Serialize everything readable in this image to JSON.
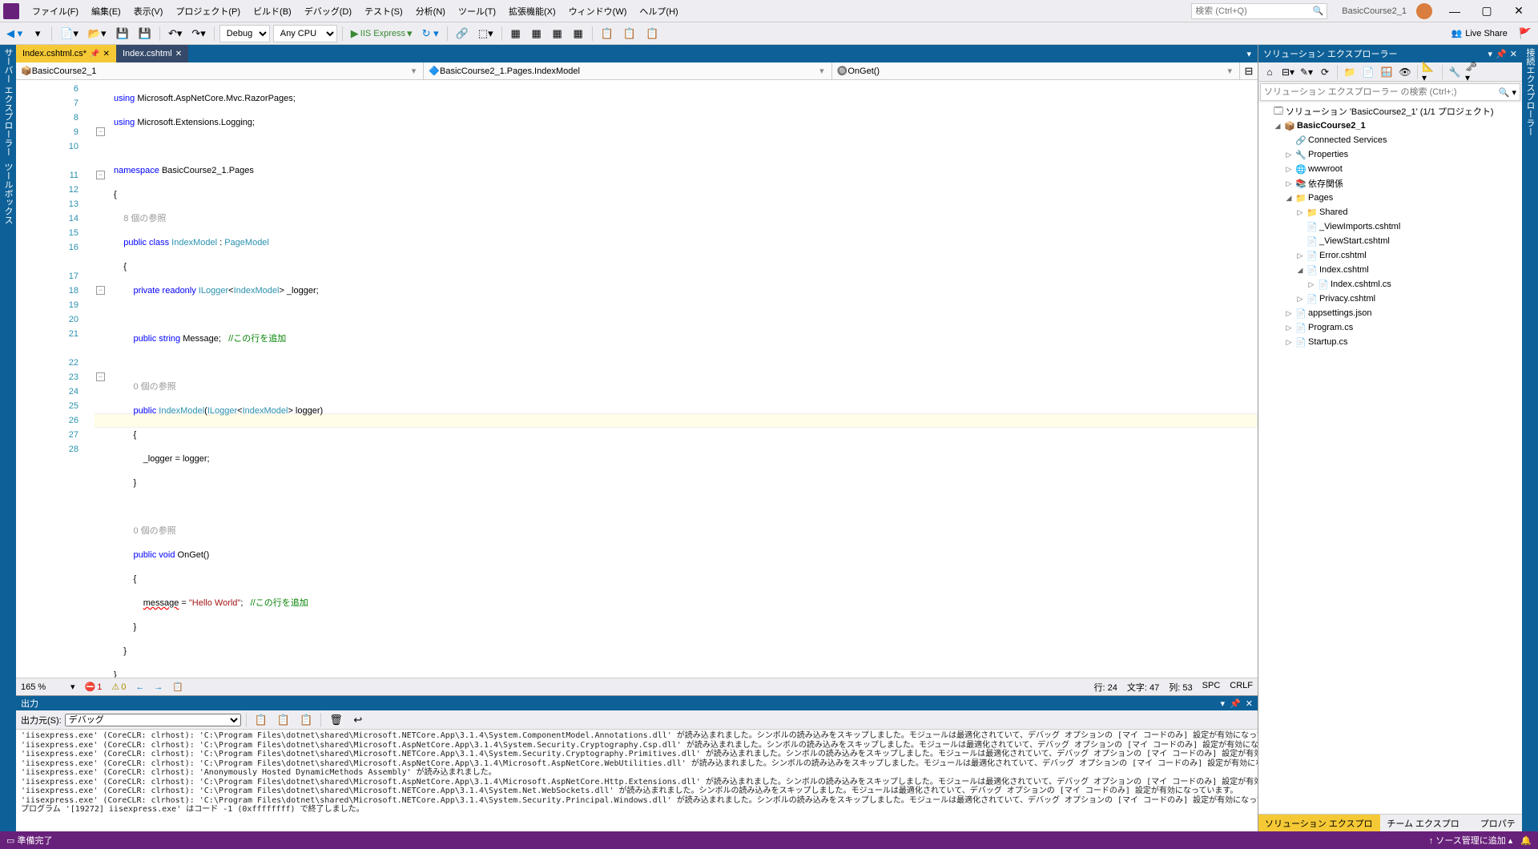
{
  "title": {
    "solution": "BasicCourse2_1"
  },
  "menu": [
    "ファイル(F)",
    "編集(E)",
    "表示(V)",
    "プロジェクト(P)",
    "ビルド(B)",
    "デバッグ(D)",
    "テスト(S)",
    "分析(N)",
    "ツール(T)",
    "拡張機能(X)",
    "ウィンドウ(W)",
    "ヘルプ(H)"
  ],
  "search": {
    "placeholder": "検索 (Ctrl+Q)"
  },
  "toolbar": {
    "config": "Debug",
    "platform": "Any CPU",
    "run": "IIS Express",
    "liveshare": "Live Share"
  },
  "tabs": [
    {
      "label": "Index.cshtml.cs*",
      "active": true,
      "pinned": true
    },
    {
      "label": "Index.cshtml",
      "active": false
    }
  ],
  "navbar": {
    "scope": "BasicCourse2_1",
    "class": "BasicCourse2_1.Pages.IndexModel",
    "member": "OnGet()"
  },
  "code": {
    "lines": [
      6,
      7,
      8,
      9,
      10,
      11,
      12,
      13,
      14,
      15,
      16,
      17,
      18,
      19,
      20,
      21,
      22,
      23,
      24,
      25,
      26,
      27,
      28
    ],
    "ref1": "8 個の参照",
    "ref2": "0 個の参照",
    "ref3": "0 個の参照",
    "t_using": "using",
    "t_ns": "namespace",
    "t_pub": "public",
    "t_cls": "class",
    "t_priv": "private",
    "t_ro": "readonly",
    "t_str": "string",
    "t_void": "void",
    "ns": "Microsoft.AspNetCore.Mvc.RazorPages",
    "ns2": "Microsoft.Extensions.Logging",
    "nsdecl": "BasicCourse2_1.Pages",
    "clsname": "IndexModel",
    "base": "PageModel",
    "ilog": "ILogger",
    "logfield": "_logger",
    "msg": "Message",
    "onget": "OnGet",
    "hello": "\"Hello World\"",
    "msgerr": "message",
    "c1": "//この行を追加",
    "c2": "//この行を追加",
    "logger": "logger"
  },
  "edstatus": {
    "zoom": "165 %",
    "err": "1",
    "warn": "0",
    "line": "行: 24",
    "ch": "文字: 47",
    "col": "列: 53",
    "spc": "SPC",
    "crlf": "CRLF"
  },
  "solExp": {
    "title": "ソリューション エクスプローラー",
    "search": "ソリューション エクスプローラー の検索 (Ctrl+;)",
    "tree": [
      {
        "d": 0,
        "tw": "",
        "i": "🗔",
        "t": "ソリューション 'BasicCourse2_1' (1/1 プロジェクト)"
      },
      {
        "d": 1,
        "tw": "◢",
        "i": "📦",
        "t": "BasicCourse2_1",
        "bold": true
      },
      {
        "d": 2,
        "tw": "",
        "i": "🔗",
        "t": "Connected Services"
      },
      {
        "d": 2,
        "tw": "▷",
        "i": "🔧",
        "t": "Properties"
      },
      {
        "d": 2,
        "tw": "▷",
        "i": "🌐",
        "t": "wwwroot"
      },
      {
        "d": 2,
        "tw": "▷",
        "i": "📚",
        "t": "依存関係"
      },
      {
        "d": 2,
        "tw": "◢",
        "i": "📁",
        "t": "Pages"
      },
      {
        "d": 3,
        "tw": "▷",
        "i": "📁",
        "t": "Shared"
      },
      {
        "d": 3,
        "tw": "",
        "i": "📄",
        "t": "_ViewImports.cshtml"
      },
      {
        "d": 3,
        "tw": "",
        "i": "📄",
        "t": "_ViewStart.cshtml"
      },
      {
        "d": 3,
        "tw": "▷",
        "i": "📄",
        "t": "Error.cshtml"
      },
      {
        "d": 3,
        "tw": "◢",
        "i": "📄",
        "t": "Index.cshtml"
      },
      {
        "d": 4,
        "tw": "▷",
        "i": "📄",
        "t": "Index.cshtml.cs"
      },
      {
        "d": 3,
        "tw": "▷",
        "i": "📄",
        "t": "Privacy.cshtml"
      },
      {
        "d": 2,
        "tw": "▷",
        "i": "📄",
        "t": "appsettings.json"
      },
      {
        "d": 2,
        "tw": "▷",
        "i": "📄",
        "t": "Program.cs"
      },
      {
        "d": 2,
        "tw": "▷",
        "i": "📄",
        "t": "Startup.cs"
      }
    ],
    "tabs": [
      "ソリューション エクスプローラー",
      "チーム エクスプローラー",
      "プロパティ"
    ]
  },
  "rightStrip": "接続エクスプローラー",
  "leftStrip": [
    "サーバー エクスプローラー",
    "ツールボックス"
  ],
  "output": {
    "title": "出力",
    "srcLabel": "出力元(S):",
    "src": "デバッグ",
    "lines": [
      "'iisexpress.exe' (CoreCLR: clrhost): 'C:\\Program Files\\dotnet\\shared\\Microsoft.NETCore.App\\3.1.4\\System.ComponentModel.Annotations.dll' が読み込まれました。シンボルの読み込みをスキップしました。モジュールは最適化されていて、デバッグ オプションの [マイ コードのみ] 設定が有効になっています。",
      "'iisexpress.exe' (CoreCLR: clrhost): 'C:\\Program Files\\dotnet\\shared\\Microsoft.AspNetCore.App\\3.1.4\\System.Security.Cryptography.Csp.dll' が読み込まれました。シンボルの読み込みをスキップしました。モジュールは最適化されていて、デバッグ オプションの [マイ コードのみ] 設定が有効になっています。",
      "'iisexpress.exe' (CoreCLR: clrhost): 'C:\\Program Files\\dotnet\\shared\\Microsoft.NETCore.App\\3.1.4\\System.Security.Cryptography.Primitives.dll' が読み込まれました。シンボルの読み込みをスキップしました。モジュールは最適化されていて、デバッグ オプションの [マイ コードのみ] 設定が有効になっています。",
      "'iisexpress.exe' (CoreCLR: clrhost): 'C:\\Program Files\\dotnet\\shared\\Microsoft.AspNetCore.App\\3.1.4\\Microsoft.AspNetCore.WebUtilities.dll' が読み込まれました。シンボルの読み込みをスキップしました。モジュールは最適化されていて、デバッグ オプションの [マイ コードのみ] 設定が有効になっています。",
      "'iisexpress.exe' (CoreCLR: clrhost): 'Anonymously Hosted DynamicMethods Assembly' が読み込まれました。",
      "'iisexpress.exe' (CoreCLR: clrhost): 'C:\\Program Files\\dotnet\\shared\\Microsoft.AspNetCore.App\\3.1.4\\Microsoft.AspNetCore.Http.Extensions.dll' が読み込まれました。シンボルの読み込みをスキップしました。モジュールは最適化されていて、デバッグ オプションの [マイ コードのみ] 設定が有効になっています。",
      "'iisexpress.exe' (CoreCLR: clrhost): 'C:\\Program Files\\dotnet\\shared\\Microsoft.NETCore.App\\3.1.4\\System.Net.WebSockets.dll' が読み込まれました。シンボルの読み込みをスキップしました。モジュールは最適化されていて、デバッグ オプションの [マイ コードのみ] 設定が有効になっています。",
      "'iisexpress.exe' (CoreCLR: clrhost): 'C:\\Program Files\\dotnet\\shared\\Microsoft.NETCore.App\\3.1.4\\System.Security.Principal.Windows.dll' が読み込まれました。シンボルの読み込みをスキップしました。モジュールは最適化されていて、デバッグ オプションの [マイ コードのみ] 設定が有効になっています。",
      "プログラム '[19272] iisexpress.exe' はコード -1 (0xffffffff) で終了しました。"
    ]
  },
  "statusbar": {
    "ready": "準備完了",
    "src": "ソース管理に追加 ▴"
  }
}
